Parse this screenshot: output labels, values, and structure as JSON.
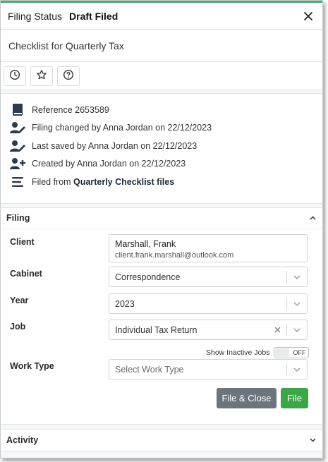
{
  "header": {
    "status_label": "Filing Status",
    "status_value": "Draft Filed"
  },
  "title": "Checklist for Quarterly Tax",
  "toolbar": {
    "buttons": [
      "history-icon",
      "star-icon",
      "help-icon"
    ]
  },
  "info": {
    "reference": "Reference 2653589",
    "changed": "Filing changed by Anna Jordan on 22/12/2023",
    "saved": "Last saved by Anna Jordan on 22/12/2023",
    "created": "Created by Anna Jordan on 22/12/2023",
    "filed_prefix": "Filed from ",
    "filed_source": "Quarterly Checklist files"
  },
  "filing": {
    "heading": "Filing",
    "client_label": "Client",
    "client_name": "Marshall, Frank",
    "client_email": "client.frank.marshall@outlook.com",
    "cabinet_label": "Cabinet",
    "cabinet_value": "Correspondence",
    "year_label": "Year",
    "year_value": "2023",
    "job_label": "Job",
    "job_value": "Individual Tax Return",
    "inactive_jobs_label": "Show Inactive Jobs",
    "inactive_jobs_state": "OFF",
    "worktype_label": "Work Type",
    "worktype_placeholder": "Select Work Type",
    "file_close_label": "File & Close",
    "file_label": "File"
  },
  "activity": {
    "heading": "Activity"
  },
  "colors": {
    "accent_green": "#3aa648",
    "top_bar": "#4caf6e",
    "secondary_button": "#6c757d"
  }
}
